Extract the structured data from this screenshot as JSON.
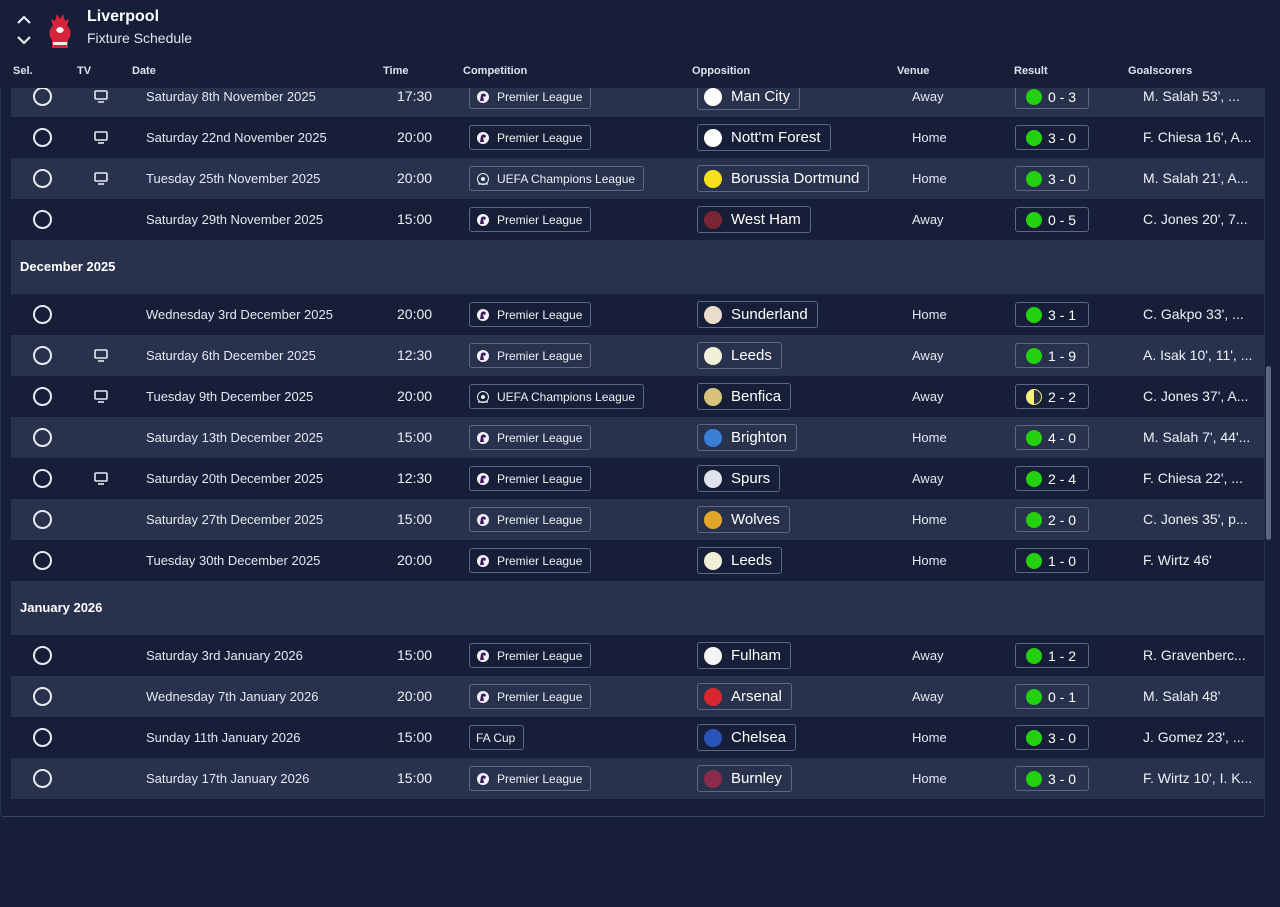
{
  "header": {
    "team_name": "Liverpool",
    "page_title": "Fixture Schedule"
  },
  "columns": {
    "sel": "Sel.",
    "tv": "TV",
    "date": "Date",
    "time": "Time",
    "competition": "Competition",
    "opposition": "Opposition",
    "venue": "Venue",
    "result": "Result",
    "goalscorers": "Goalscorers"
  },
  "groups": [
    {
      "month": "",
      "fixtures": [
        {
          "tv": true,
          "date": "Saturday 8th November 2025",
          "time": "17:30",
          "competition": "Premier League",
          "comp_icon": "premier-league-icon",
          "opposition": "Man City",
          "badge_color": "#ffffff",
          "venue": "Away",
          "result": "0 - 3",
          "outcome": "win",
          "scorers": "M. Salah 53', ..."
        },
        {
          "tv": true,
          "date": "Saturday 22nd November 2025",
          "time": "20:00",
          "competition": "Premier League",
          "comp_icon": "premier-league-icon",
          "opposition": "Nott'm Forest",
          "badge_color": "#ffffff",
          "venue": "Home",
          "result": "3 - 0",
          "outcome": "win",
          "scorers": "F. Chiesa 16', A..."
        },
        {
          "tv": true,
          "date": "Tuesday 25th November 2025",
          "time": "20:00",
          "competition": "UEFA Champions League",
          "comp_icon": "champions-league-icon",
          "opposition": "Borussia Dortmund",
          "badge_color": "#f5e01b",
          "venue": "Home",
          "result": "3 - 0",
          "outcome": "win",
          "scorers": "M. Salah 21', A..."
        },
        {
          "tv": false,
          "date": "Saturday 29th November 2025",
          "time": "15:00",
          "competition": "Premier League",
          "comp_icon": "premier-league-icon",
          "opposition": "West Ham",
          "badge_color": "#7a2634",
          "venue": "Away",
          "result": "0 - 5",
          "outcome": "win",
          "scorers": "C. Jones 20', 7..."
        }
      ]
    },
    {
      "month": "December 2025",
      "fixtures": [
        {
          "tv": false,
          "date": "Wednesday 3rd December 2025",
          "time": "20:00",
          "competition": "Premier League",
          "comp_icon": "premier-league-icon",
          "opposition": "Sunderland",
          "badge_color": "#e8dccb",
          "venue": "Home",
          "result": "3 - 1",
          "outcome": "win",
          "scorers": "C. Gakpo 33', ..."
        },
        {
          "tv": true,
          "date": "Saturday 6th December 2025",
          "time": "12:30",
          "competition": "Premier League",
          "comp_icon": "premier-league-icon",
          "opposition": "Leeds",
          "badge_color": "#f2efd8",
          "venue": "Away",
          "result": "1 - 9",
          "outcome": "win",
          "scorers": "A. Isak 10', 11', ..."
        },
        {
          "tv": true,
          "date": "Tuesday 9th December 2025",
          "time": "20:00",
          "competition": "UEFA Champions League",
          "comp_icon": "champions-league-icon",
          "opposition": "Benfica",
          "badge_color": "#d9c37a",
          "venue": "Away",
          "result": "2 - 2",
          "outcome": "draw",
          "scorers": "C. Jones 37', A..."
        },
        {
          "tv": false,
          "date": "Saturday 13th December 2025",
          "time": "15:00",
          "competition": "Premier League",
          "comp_icon": "premier-league-icon",
          "opposition": "Brighton",
          "badge_color": "#3a7fd6",
          "venue": "Home",
          "result": "4 - 0",
          "outcome": "win",
          "scorers": "M. Salah 7', 44'..."
        },
        {
          "tv": true,
          "date": "Saturday 20th December 2025",
          "time": "12:30",
          "competition": "Premier League",
          "comp_icon": "premier-league-icon",
          "opposition": "Spurs",
          "badge_color": "#dfe3ec",
          "venue": "Away",
          "result": "2 - 4",
          "outcome": "win",
          "scorers": "F. Chiesa 22', ..."
        },
        {
          "tv": false,
          "date": "Saturday 27th December 2025",
          "time": "15:00",
          "competition": "Premier League",
          "comp_icon": "premier-league-icon",
          "opposition": "Wolves",
          "badge_color": "#e2a72a",
          "venue": "Home",
          "result": "2 - 0",
          "outcome": "win",
          "scorers": "C. Jones 35', p..."
        },
        {
          "tv": false,
          "date": "Tuesday 30th December 2025",
          "time": "20:00",
          "competition": "Premier League",
          "comp_icon": "premier-league-icon",
          "opposition": "Leeds",
          "badge_color": "#f2efd8",
          "venue": "Home",
          "result": "1 - 0",
          "outcome": "win",
          "scorers": "F. Wirtz 46'"
        }
      ]
    },
    {
      "month": "January 2026",
      "fixtures": [
        {
          "tv": false,
          "date": "Saturday 3rd January 2026",
          "time": "15:00",
          "competition": "Premier League",
          "comp_icon": "premier-league-icon",
          "opposition": "Fulham",
          "badge_color": "#f4f4f4",
          "venue": "Away",
          "result": "1 - 2",
          "outcome": "win",
          "scorers": "R. Gravenberc..."
        },
        {
          "tv": false,
          "date": "Wednesday 7th January 2026",
          "time": "20:00",
          "competition": "Premier League",
          "comp_icon": "premier-league-icon",
          "opposition": "Arsenal",
          "badge_color": "#d8262e",
          "venue": "Away",
          "result": "0 - 1",
          "outcome": "win",
          "scorers": "M. Salah 48'"
        },
        {
          "tv": false,
          "date": "Sunday 11th January 2026",
          "time": "15:00",
          "competition": "FA Cup",
          "comp_icon": "",
          "opposition": "Chelsea",
          "badge_color": "#2b54b8",
          "venue": "Home",
          "result": "3 - 0",
          "outcome": "win",
          "scorers": "J. Gomez 23', ..."
        },
        {
          "tv": false,
          "date": "Saturday 17th January 2026",
          "time": "15:00",
          "competition": "Premier League",
          "comp_icon": "premier-league-icon",
          "opposition": "Burnley",
          "badge_color": "#8a2b4a",
          "venue": "Home",
          "result": "3 - 0",
          "outcome": "win",
          "scorers": "F. Wirtz 10', I. K..."
        }
      ]
    }
  ]
}
